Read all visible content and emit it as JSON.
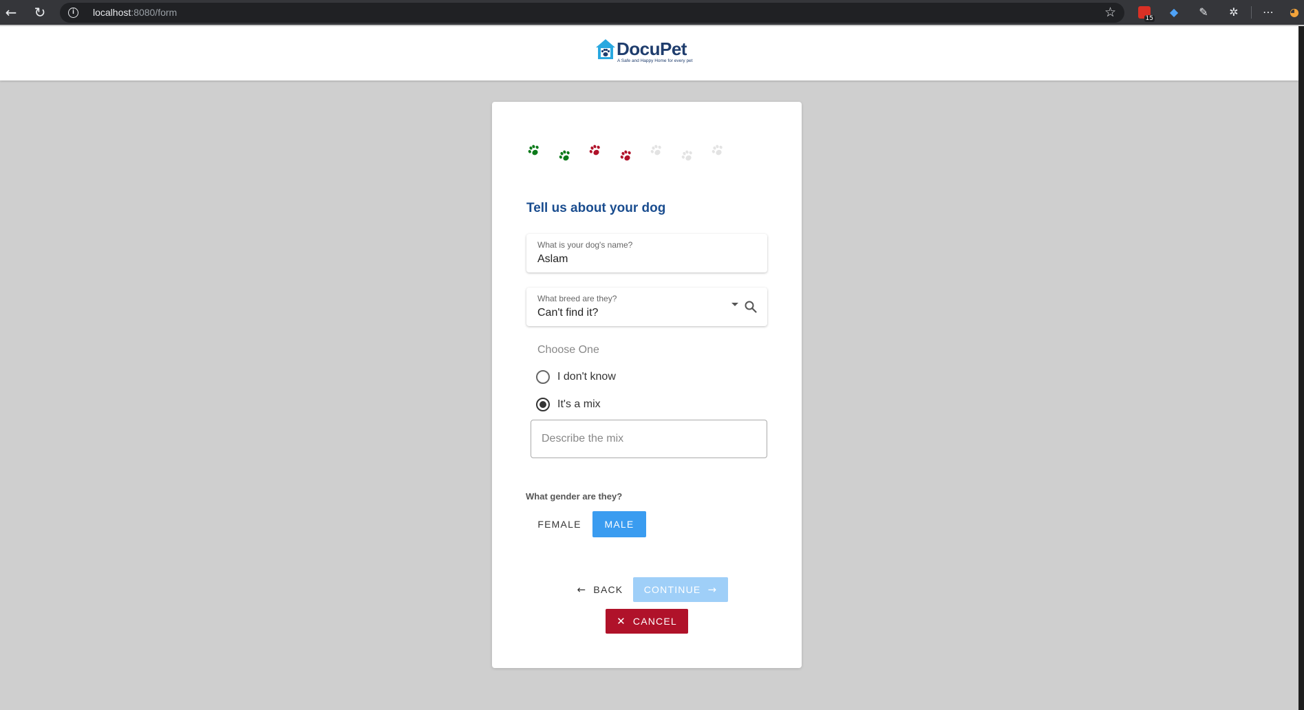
{
  "browser": {
    "url_host": "localhost",
    "url_path": ":8080/form",
    "calendar_badge": "15"
  },
  "header": {
    "logo_name": "DocuPet",
    "logo_tagline": "A Safe and Happy Home for every pet"
  },
  "progress": {
    "paws": [
      {
        "state": "complete",
        "color": "#0b7a1a"
      },
      {
        "state": "complete",
        "color": "#0b7a1a"
      },
      {
        "state": "current",
        "color": "#b0122a"
      },
      {
        "state": "current",
        "color": "#b0122a"
      },
      {
        "state": "pending",
        "color": "#e3e3e3"
      },
      {
        "state": "pending",
        "color": "#e3e3e3"
      },
      {
        "state": "pending",
        "color": "#e3e3e3"
      }
    ]
  },
  "form": {
    "title": "Tell us about your dog",
    "name_field": {
      "label": "What is your dog's name?",
      "value": "Aslam"
    },
    "breed_field": {
      "label": "What breed are they?",
      "value": "Can't find it?"
    },
    "choose_label": "Choose One",
    "radio_options": [
      {
        "label": "I don't know",
        "checked": false
      },
      {
        "label": "It's a mix",
        "checked": true
      }
    ],
    "mix_placeholder": "Describe the mix",
    "gender_question": "What gender are they?",
    "gender_options": {
      "female": "FEMALE",
      "male": "MALE",
      "selected": "male"
    }
  },
  "actions": {
    "back": "BACK",
    "continue": "CONTINUE",
    "cancel": "CANCEL"
  },
  "colors": {
    "accent": "#3a9cf0",
    "title": "#1a4d8f",
    "cancel": "#b0122a",
    "continue_disabled": "#9fcff8"
  }
}
